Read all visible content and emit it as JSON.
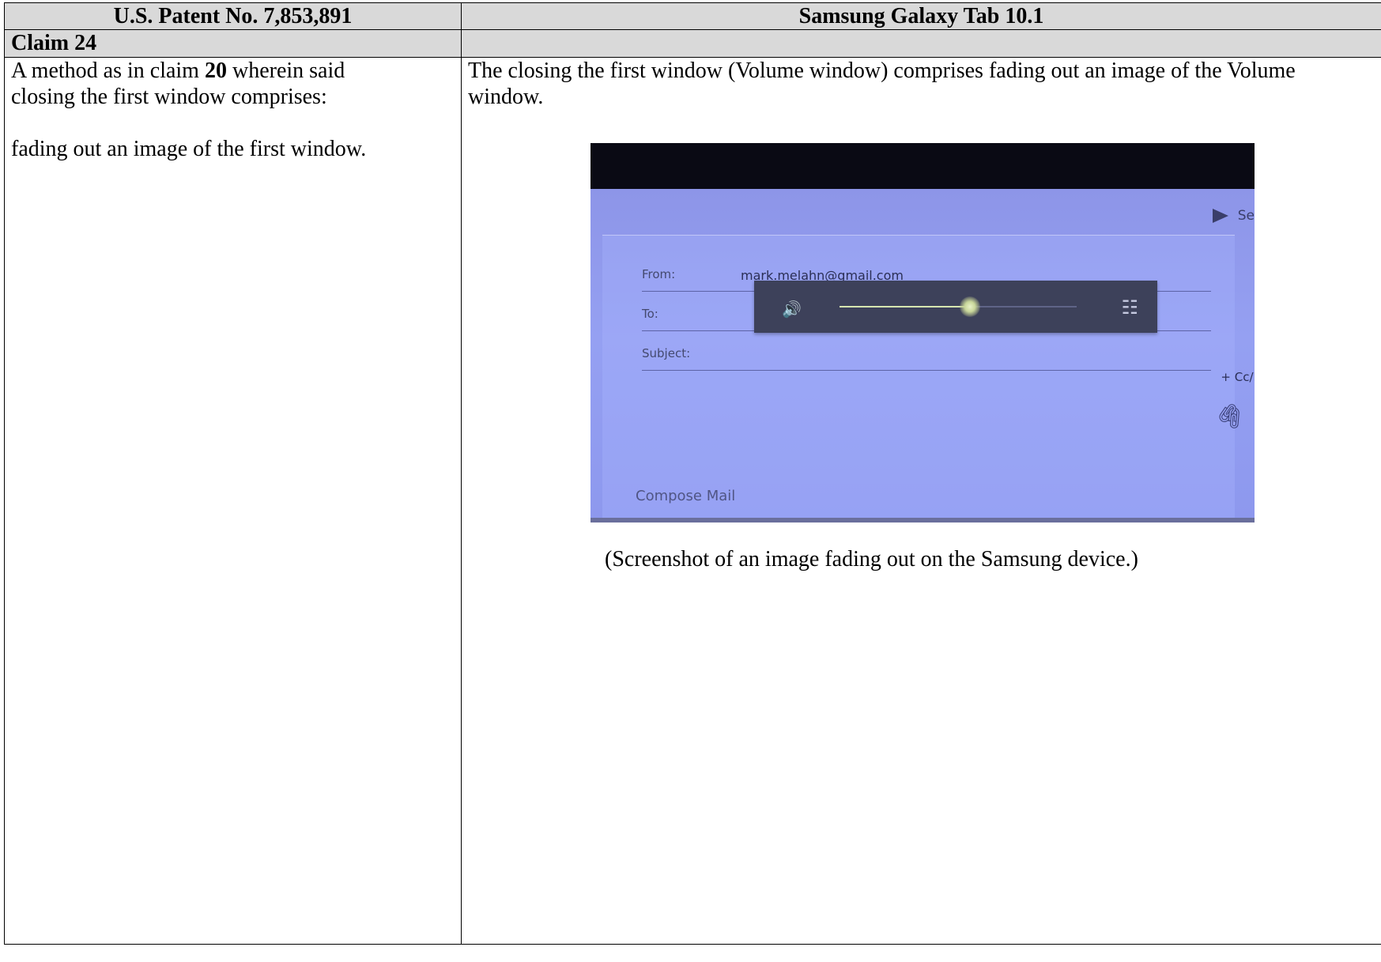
{
  "header": {
    "left": "U.S. Patent No. 7,853,891",
    "right": "Samsung Galaxy Tab 10.1"
  },
  "claim_row": {
    "label": "Claim 24"
  },
  "left_cell": {
    "line1_prefix": "A method as in claim ",
    "line1_bold": "20",
    "line1_suffix": " wherein said",
    "line2": "closing the first window comprises:",
    "line3": "fading out an image of the first window."
  },
  "right_cell": {
    "paragraph": "The closing the first window (Volume window) comprises fading out an image of the Volume window.",
    "caption": "(Screenshot of an image fading out on the Samsung device.)"
  },
  "screenshot": {
    "send_label": "Se",
    "from_label": "From:",
    "from_value": "mark.melahn@gmail.com",
    "to_label": "To:",
    "subject_label": "Subject:",
    "cc_label": "+ Cc/E",
    "compose_label": "Compose Mail",
    "volume_level": 0.55
  },
  "colors": {
    "header_bg": "#d9d9d9",
    "screen_bg": "#8d95e8",
    "volume_window_bg": "#3d415a"
  }
}
